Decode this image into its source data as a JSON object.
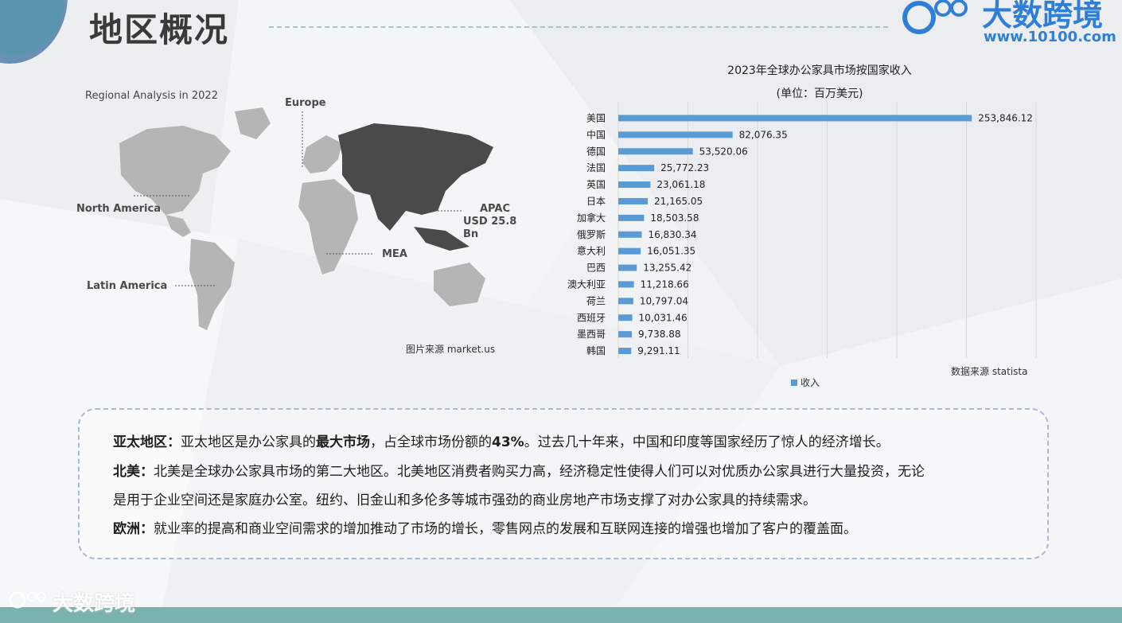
{
  "header": {
    "title": "地区概况",
    "logo_text": "大数跨境",
    "logo_url": "www.10100.com"
  },
  "map": {
    "caption": "Regional Analysis in 2022",
    "labels": {
      "europe": "Europe",
      "north_america": "North America",
      "apac": "APAC",
      "apac_value": "USD 25.8 Bn",
      "mea": "MEA",
      "latin_america": "Latin America"
    },
    "highlight_color": "#4a4a4a",
    "base_color": "#b5b5b5",
    "source": "图片来源 market.us"
  },
  "chart_data": {
    "type": "bar",
    "orientation": "horizontal",
    "title": "2023年全球办公家具市场按国家收入",
    "subtitle": "(单位：百万美元)",
    "categories": [
      "美国",
      "中国",
      "德国",
      "法国",
      "英国",
      "日本",
      "加拿大",
      "俄罗斯",
      "意大利",
      "巴西",
      "澳大利亚",
      "荷兰",
      "西班牙",
      "墨西哥",
      "韩国"
    ],
    "series": [
      {
        "name": "收入",
        "color": "#5b9bd5",
        "values": [
          253846.12,
          82076.35,
          53520.06,
          25772.23,
          23061.18,
          21165.05,
          18503.58,
          16830.34,
          16051.35,
          13255.42,
          11218.66,
          10797.04,
          10031.46,
          9738.88,
          9291.11
        ]
      }
    ],
    "value_labels": [
      "253,846.12",
      "82,076.35",
      "53,520.06",
      "25,772.23",
      "23,061.18",
      "21,165.05",
      "18,503.58",
      "16,830.34",
      "16,051.35",
      "13,255.42",
      "11,218.66",
      "10,797.04",
      "10,031.46",
      "9,738.88",
      "9,291.11"
    ],
    "xlim": [
      0,
      300000
    ],
    "grid": true,
    "legend": "bottom",
    "source": "数据来源 statista"
  },
  "notes": {
    "apac_label": "亚太地区：",
    "apac_text_1": "亚太地区是办公家具的",
    "apac_bold": "最大市场",
    "apac_text_2": "，占全球市场份额的",
    "apac_share": "43%",
    "apac_text_3": "。过去几十年来，中国和印度等国家经历了惊人的经济增长。",
    "na_label": "北美：",
    "na_text_1": "北美是全球办公家具市场的第二大地区。北美地区消费者购买力高，经济稳定性使得人们可以对优质办公家具进行大量投资，无论",
    "na_text_2": "是用于企业空间还是家庭办公室。纽约、旧金山和多伦多等城市强劲的商业房地产市场支撑了对办公家具的持续需求。",
    "eu_label": "欧洲：",
    "eu_text": "就业率的提高和商业空间需求的增加推动了市场的增长，零售网点的发展和互联网连接的增强也增加了客户的覆盖面。"
  },
  "watermark": "大数跨境"
}
